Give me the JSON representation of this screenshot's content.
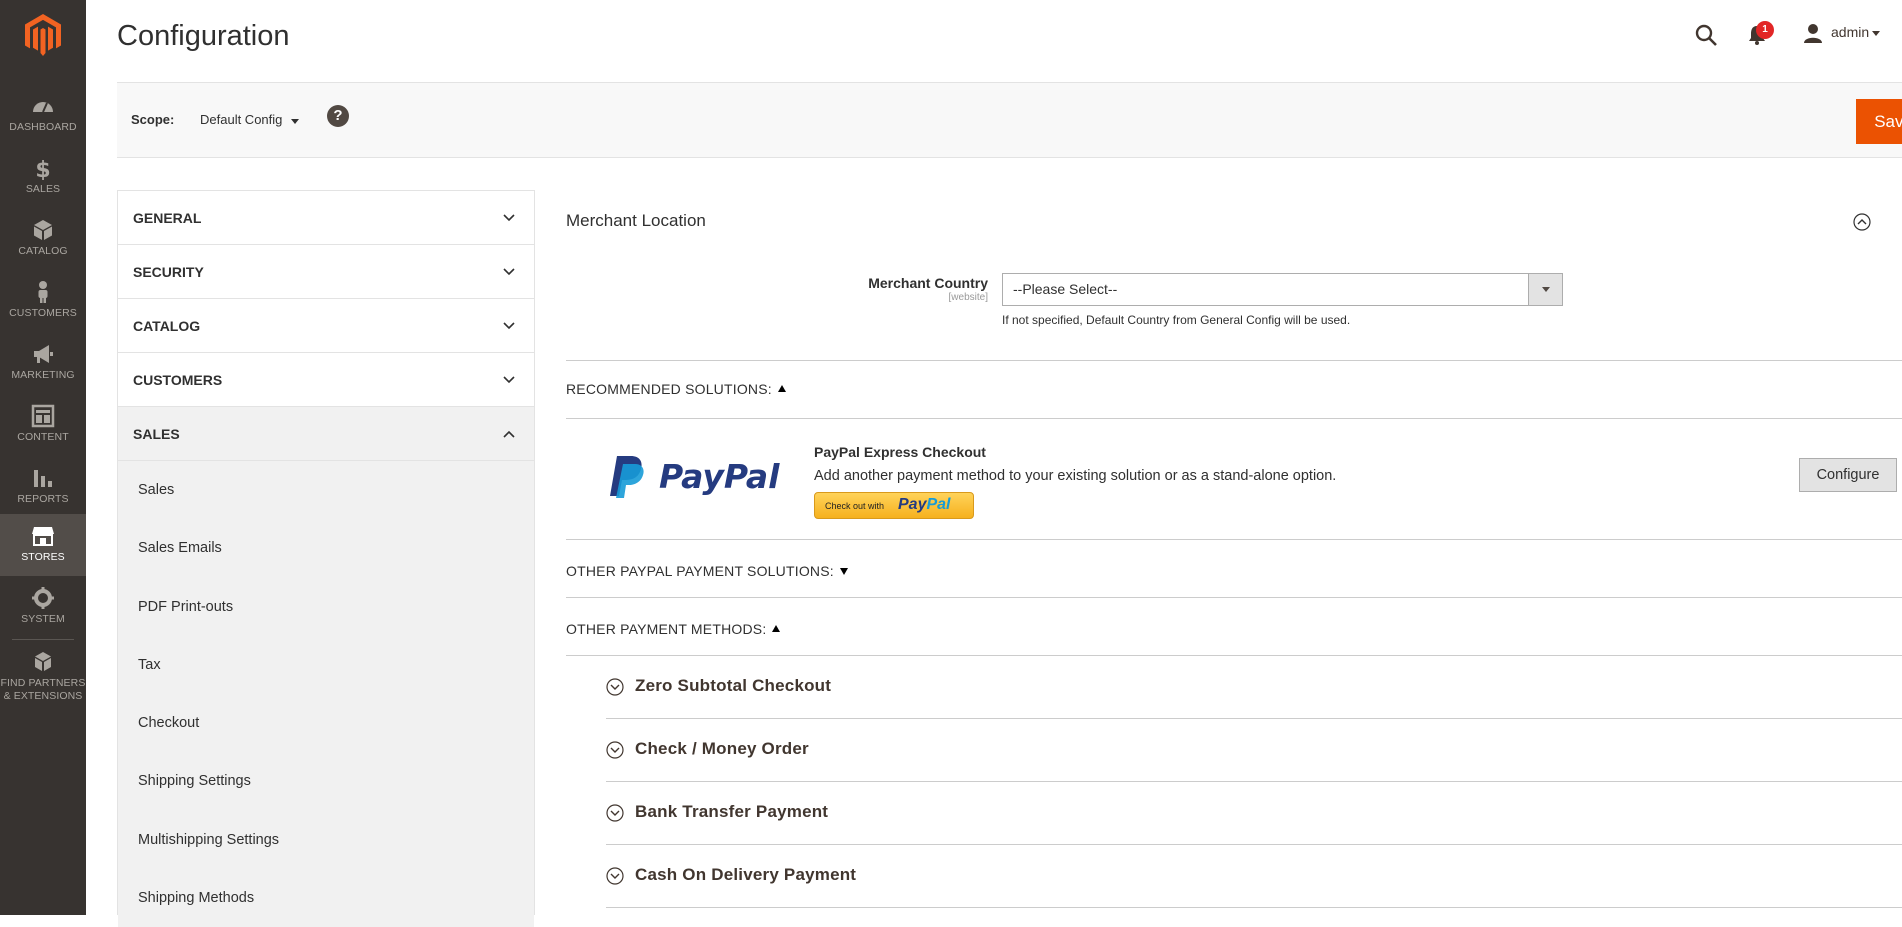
{
  "nav": {
    "items": [
      {
        "label": "DASHBOARD",
        "icon": "dashboard-icon"
      },
      {
        "label": "SALES",
        "icon": "dollar-icon"
      },
      {
        "label": "CATALOG",
        "icon": "box-icon"
      },
      {
        "label": "CUSTOMERS",
        "icon": "person-icon"
      },
      {
        "label": "MARKETING",
        "icon": "megaphone-icon"
      },
      {
        "label": "CONTENT",
        "icon": "layout-icon"
      },
      {
        "label": "REPORTS",
        "icon": "bar-chart-icon"
      },
      {
        "label": "STORES",
        "icon": "store-icon",
        "active": true
      },
      {
        "label": "SYSTEM",
        "icon": "gear-icon"
      },
      {
        "label_line1": "FIND PARTNERS",
        "label_line2": "& EXTENSIONS",
        "icon": "cubes-icon"
      }
    ]
  },
  "header": {
    "title": "Configuration",
    "notification_count": "1",
    "user": "admin"
  },
  "scope": {
    "label": "Scope:",
    "value": "Default Config",
    "help": "?",
    "save_label": "Save Config"
  },
  "tabs": {
    "sections": [
      "GENERAL",
      "SECURITY",
      "CATALOG",
      "CUSTOMERS",
      "SALES"
    ],
    "sales_items": [
      "Sales",
      "Sales Emails",
      "PDF Print-outs",
      "Tax",
      "Checkout",
      "Shipping Settings",
      "Multishipping Settings",
      "Shipping Methods"
    ]
  },
  "merchant": {
    "title": "Merchant Location",
    "field_label": "Merchant Country",
    "field_scope": "[website]",
    "select_value": "--Please Select--",
    "note": "If not specified, Default Country from General Config will be used."
  },
  "groups": {
    "recommended": "RECOMMENDED SOLUTIONS:",
    "other_paypal": "OTHER PAYPAL PAYMENT SOLUTIONS:",
    "other_methods": "OTHER PAYMENT METHODS:"
  },
  "paypal": {
    "logo_text": "PayPal",
    "title": "PayPal Express Checkout",
    "description": "Add another payment method to your existing solution or as a stand-alone option.",
    "btn_text": "Check out with",
    "btn_brand_a": "Pay",
    "btn_brand_b": "Pal",
    "configure": "Configure"
  },
  "payment_methods": [
    "Zero Subtotal Checkout",
    "Check / Money Order",
    "Bank Transfer Payment",
    "Cash On Delivery Payment"
  ]
}
